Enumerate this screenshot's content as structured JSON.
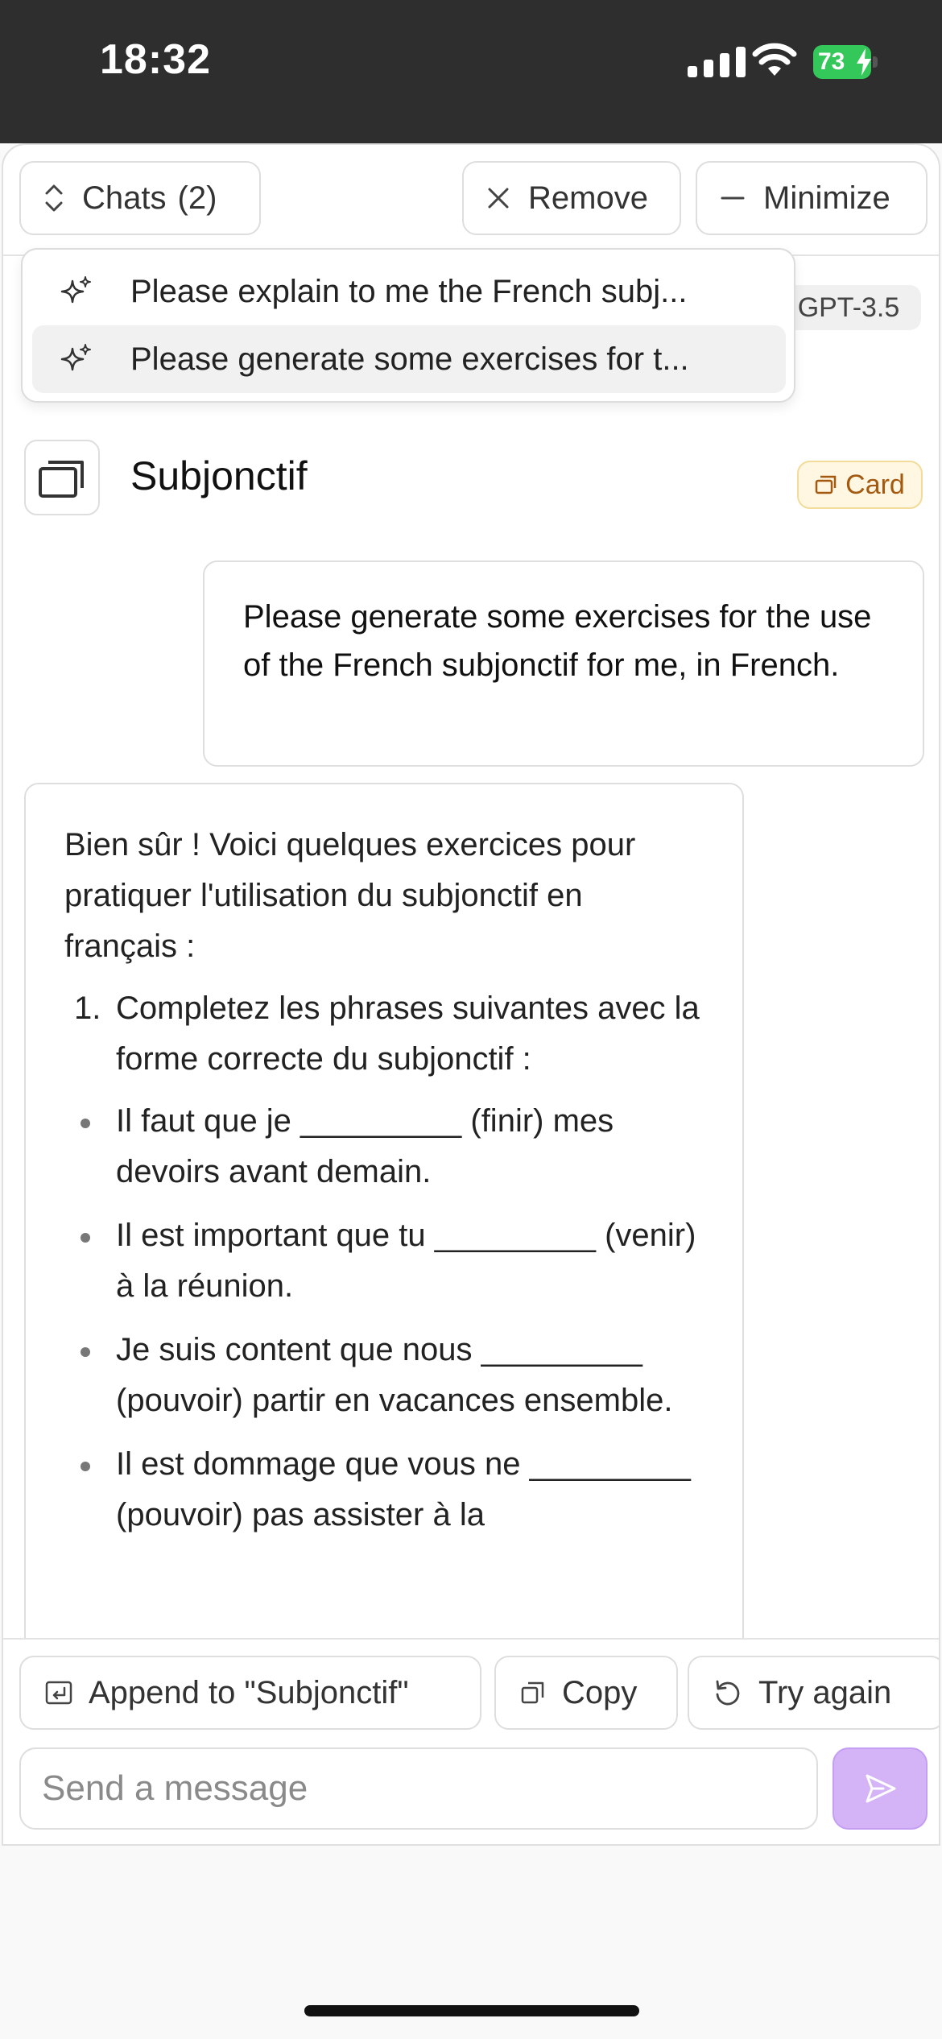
{
  "status": {
    "time": "18:32",
    "battery": "73"
  },
  "toolbar": {
    "chats_label": "Chats",
    "chats_count": "(2)",
    "remove_label": "Remove",
    "minimize_label": "Minimize"
  },
  "dropdown": {
    "items": [
      {
        "label": "Please explain to me the French subj..."
      },
      {
        "label": "Please generate some exercises for t..."
      }
    ]
  },
  "model_badge": "GPT-3.5",
  "card": {
    "title": "Subjonctif",
    "badge": "Card"
  },
  "conversation": {
    "user_message": "Please generate some exercises for the use of the French subjonctif for me, in French.",
    "assistant_intro": "Bien sûr ! Voici quelques exercices pour pratiquer l'utilisation du subjonctif en français :",
    "numbered_item": "Completez les phrases suivantes avec la forme correcte du subjonctif :",
    "bullets": [
      "Il faut que je _________ (finir) mes devoirs avant demain.",
      "Il est important que tu _________ (venir) à la réunion.",
      "Je suis content que nous _________ (pouvoir) partir en vacances ensemble.",
      "Il est dommage que vous ne _________ (pouvoir) pas assister à la"
    ]
  },
  "actions": {
    "append_label": "Append to \"Subjonctif\"",
    "copy_label": "Copy",
    "retry_label": "Try again"
  },
  "composer": {
    "placeholder": "Send a message"
  },
  "colors": {
    "status_bar": "#2e2e2e",
    "battery_green": "#34c759",
    "send_button": "#d4b3f7",
    "card_badge_bg": "#fff7e2",
    "card_badge_text": "#a35a10"
  }
}
